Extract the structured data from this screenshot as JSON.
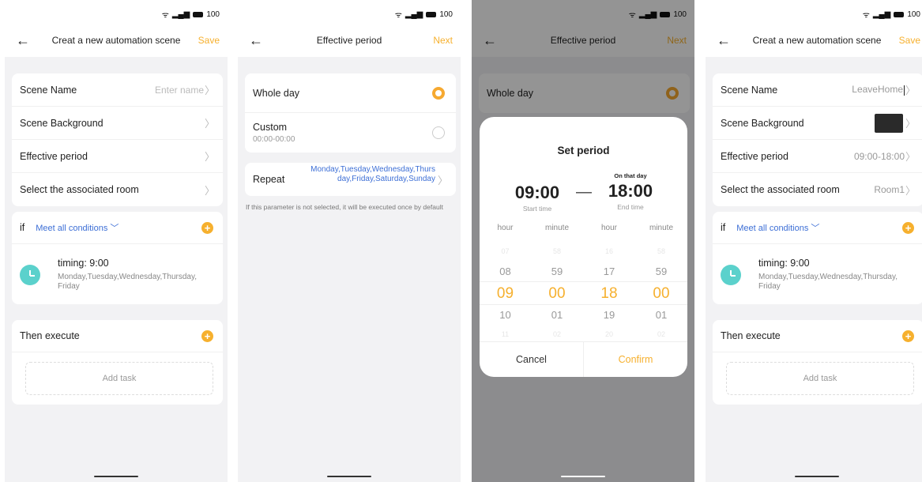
{
  "status": {
    "battery": "100"
  },
  "s1": {
    "title": "Creat a new automation scene",
    "action": "Save",
    "rows": [
      {
        "label": "Scene Name",
        "value": "Enter name"
      },
      {
        "label": "Scene Background",
        "value": ""
      },
      {
        "label": "Effective period",
        "value": ""
      },
      {
        "label": "Select the associated room",
        "value": ""
      }
    ],
    "if_label": "if",
    "condition_mode": "Meet all conditions",
    "timing_title": "timing: 9:00",
    "timing_days": "Monday,Tuesday,Wednesday,Thursday,Friday",
    "then_label": "Then execute",
    "add_task": "Add task"
  },
  "s2": {
    "title": "Effective period",
    "action": "Next",
    "whole_day": "Whole day",
    "custom": "Custom",
    "custom_range": "00:00-00:00",
    "repeat": "Repeat",
    "repeat_days": "Monday,Tuesday,Wednesday,Thursday,Friday,Saturday,Sunday",
    "note": "If this parameter is not selected, it will be executed once by default"
  },
  "s3": {
    "title": "Effective period",
    "action": "Next",
    "whole_day": "Whole day",
    "modal_title": "Set period",
    "start_time": "09:00",
    "start_label": "Start time",
    "end_caption": "On that day",
    "end_time": "18:00",
    "end_label": "End time",
    "dash": "—",
    "col_labels": [
      "hour",
      "minute",
      "hour",
      "minute"
    ],
    "wheel": [
      [
        "07",
        "58",
        "16",
        "58"
      ],
      [
        "08",
        "59",
        "17",
        "59"
      ],
      [
        "09",
        "00",
        "18",
        "00"
      ],
      [
        "10",
        "01",
        "19",
        "01"
      ],
      [
        "11",
        "02",
        "20",
        "02"
      ]
    ],
    "cancel": "Cancel",
    "confirm": "Confirm"
  },
  "s4": {
    "title": "Creat a new automation scene",
    "action": "Save",
    "rows": [
      {
        "label": "Scene Name",
        "value": "LeaveHome"
      },
      {
        "label": "Scene Background",
        "value": ""
      },
      {
        "label": "Effective period",
        "value": "09:00-18:00"
      },
      {
        "label": "Select the associated room",
        "value": "Room1"
      }
    ],
    "if_label": "if",
    "condition_mode": "Meet all conditions",
    "timing_title": "timing: 9:00",
    "timing_days": "Monday,Tuesday,Wednesday,Thursday,Friday",
    "then_label": "Then execute",
    "add_task": "Add task"
  },
  "colors": {
    "accent": "#f6b02e",
    "link": "#3d6fd6",
    "clock": "#5bd1cc"
  },
  "icons": [
    "back-arrow-icon",
    "wifi-icon",
    "signal-icon",
    "battery-icon",
    "chevron-right-icon",
    "chevron-down-icon",
    "plus-icon",
    "clock-icon"
  ]
}
